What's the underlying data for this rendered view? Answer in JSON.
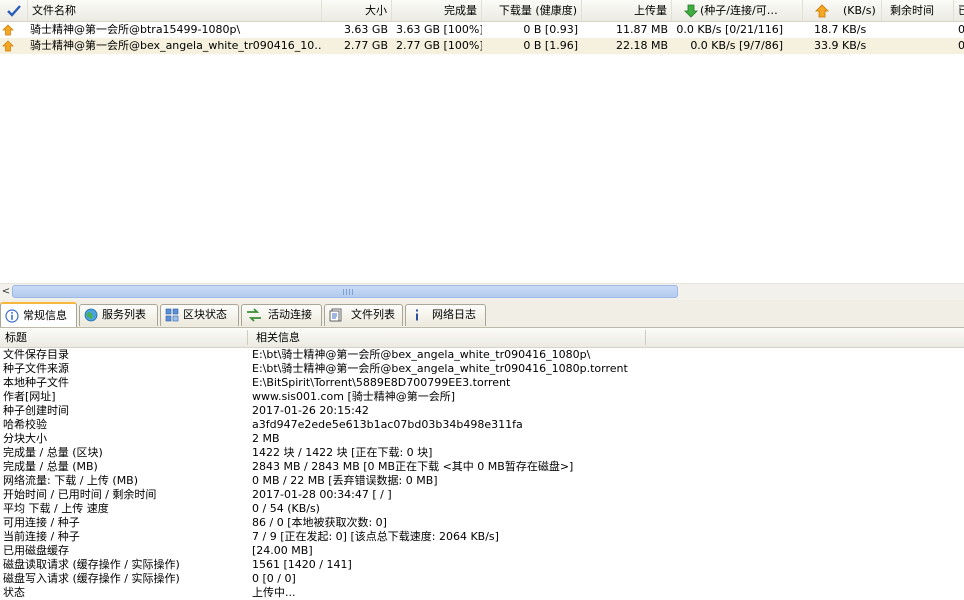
{
  "columns": {
    "name": "文件名称",
    "size": "大小",
    "done": "完成量",
    "downloaded": "下载量 (健康度)",
    "uploaded": "上传量",
    "download_rate": "(种子/连接/可…",
    "upload_rate": "(KB/s)",
    "remaining": "剩余时间",
    "extra": "已"
  },
  "torrents": [
    {
      "name": "骑士精神@第一会所@btra15499-1080p\\",
      "size": "3.63 GB",
      "done": "3.63 GB [100%]",
      "downloaded": "0 B [0.93]",
      "uploaded": "11.87 MB",
      "download_rate": "0.0 KB/s [0/21/116]",
      "upload_rate": "18.7 KB/s",
      "remaining": "",
      "extra": "0"
    },
    {
      "name": "骑士精神@第一会所@bex_angela_white_tr090416_10…",
      "size": "2.77 GB",
      "done": "2.77 GB [100%]",
      "downloaded": "0 B [1.96]",
      "uploaded": "22.18 MB",
      "download_rate": "0.0 KB/s [9/7/86]",
      "upload_rate": "33.9 KB/s",
      "remaining": "",
      "extra": "0"
    }
  ],
  "scrollbar": {
    "left_arrow": "<"
  },
  "tabs": [
    {
      "label": "常规信息",
      "icon": "info-icon",
      "active": true
    },
    {
      "label": "服务列表",
      "icon": "globe-icon",
      "active": false
    },
    {
      "label": "区块状态",
      "icon": "blocks-icon",
      "active": false
    },
    {
      "label": "活动连接",
      "icon": "connections-icon",
      "active": false
    },
    {
      "label": "文件列表",
      "icon": "file-list-icon",
      "active": false
    },
    {
      "label": "网络日志",
      "icon": "log-info-icon",
      "active": false
    }
  ],
  "info_header": {
    "key": "标题",
    "value": "相关信息"
  },
  "info_rows": [
    {
      "k": "文件保存目录",
      "v": "E:\\bt\\骑士精神@第一会所@bex_angela_white_tr090416_1080p\\"
    },
    {
      "k": "种子文件来源",
      "v": "E:\\bt\\骑士精神@第一会所@bex_angela_white_tr090416_1080p.torrent"
    },
    {
      "k": "本地种子文件",
      "v": "E:\\BitSpirit\\Torrent\\5889E8D700799EE3.torrent"
    },
    {
      "k": "作者[网址]",
      "v": "www.sis001.com [骑士精神@第一会所]"
    },
    {
      "k": "种子创建时间",
      "v": "2017-01-26 20:15:42"
    },
    {
      "k": "哈希校验",
      "v": "a3fd947e2ede5e613b1ac07bd03b34b498e311fa"
    },
    {
      "k": "分块大小",
      "v": "2 MB"
    },
    {
      "k": "完成量 / 总量 (区块)",
      "v": "1422 块 / 1422 块 [正在下载: 0 块]"
    },
    {
      "k": "完成量 / 总量 (MB)",
      "v": "2843 MB / 2843 MB [0 MB正在下载 <其中 0 MB暂存在磁盘>]"
    },
    {
      "k": "网络流量: 下载 / 上传 (MB)",
      "v": "0 MB / 22 MB [丢弃错误数据: 0 MB]"
    },
    {
      "k": "开始时间 / 已用时间 / 剩余时间",
      "v": "2017-01-28 00:34:47 [ / ]"
    },
    {
      "k": "平均 下载 / 上传 速度",
      "v": "0 / 54 (KB/s)"
    },
    {
      "k": "可用连接 / 种子",
      "v": "86 / 0 [本地被获取次数: 0]"
    },
    {
      "k": "当前连接 / 种子",
      "v": "7 / 9 [正在发起: 0] [该点总下载速度: 2064 KB/s]"
    },
    {
      "k": "已用磁盘缓存",
      "v": "[24.00 MB]"
    },
    {
      "k": "磁盘读取请求 (缓存操作 / 实际操作)",
      "v": "1561 [1420 / 141]"
    },
    {
      "k": "磁盘写入请求 (缓存操作 / 实际操作)",
      "v": "0 [0 / 0]"
    },
    {
      "k": "状态",
      "v": "上传中..."
    }
  ],
  "colors": {
    "selected_row": "#f5f1de",
    "active_tab_accent": "#f6b73c",
    "scroll_thumb": "#b3cbef"
  }
}
